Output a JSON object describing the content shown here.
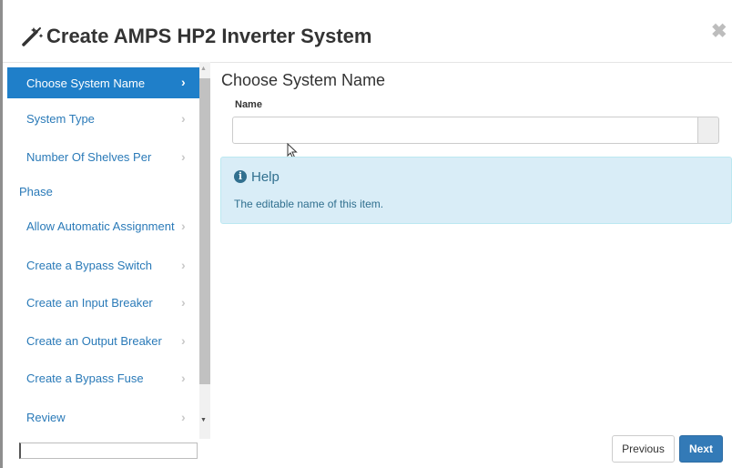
{
  "dialog": {
    "title": "Create AMPS HP2 Inverter System",
    "close_glyph": "✖",
    "title_icon": "magic-wand-icon"
  },
  "steps": [
    {
      "label": "Choose System Name",
      "active": true
    },
    {
      "label": "System Type",
      "active": false
    },
    {
      "label": "Number Of Shelves Per",
      "active": false
    },
    {
      "label": "Phase",
      "active": false
    },
    {
      "label": "Allow Automatic Assignment",
      "active": false
    },
    {
      "label": "Create a Bypass Switch",
      "active": false
    },
    {
      "label": "Create an Input Breaker",
      "active": false
    },
    {
      "label": "Create an Output Breaker",
      "active": false
    },
    {
      "label": "Create a Bypass Fuse",
      "active": false
    },
    {
      "label": "Review",
      "active": false
    }
  ],
  "chevron_glyph": "›",
  "scroll": {
    "up_glyph": "▲",
    "down_glyph": "▼"
  },
  "content": {
    "section_title": "Choose System Name",
    "field_label": "Name",
    "name_value": "",
    "name_placeholder": ""
  },
  "help": {
    "icon": "info-circle-icon",
    "icon_glyph": "i",
    "title": "Help",
    "text": "The editable name of this item."
  },
  "buttons": {
    "previous_label": "Previous",
    "next_label": "Next"
  },
  "colors": {
    "accent": "#1f7fc9",
    "link": "#2a7ab8",
    "help_bg": "#d9edf7",
    "help_text": "#31708f",
    "primary_button": "#337ab7"
  }
}
